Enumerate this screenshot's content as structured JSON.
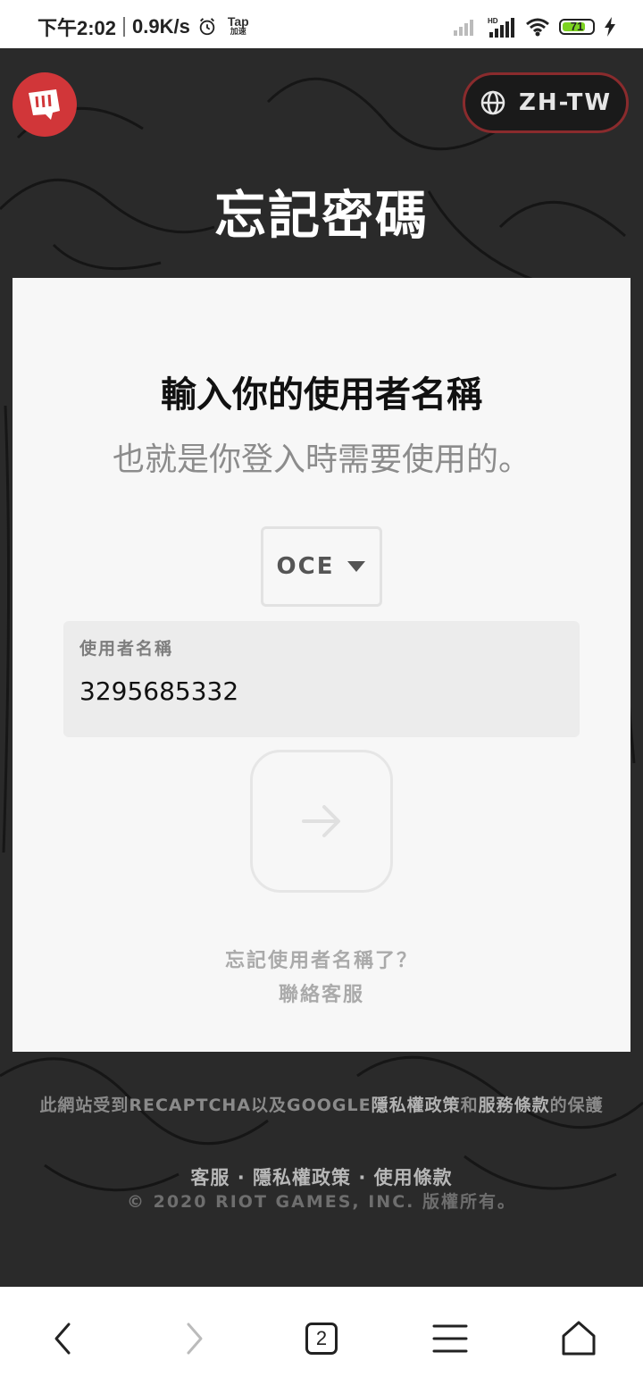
{
  "status_bar": {
    "time": "下午2:02",
    "speed": "0.9K/s",
    "tap_top": "Tap",
    "tap_bottom": "加速",
    "battery": "71",
    "icons": [
      "alarm-icon",
      "signal-icon",
      "hd-signal-icon",
      "wifi-icon",
      "battery-icon",
      "charging-icon"
    ]
  },
  "header": {
    "language_label": "ZH-TW",
    "page_title": "忘記密碼"
  },
  "card": {
    "heading": "輸入你的使用者名稱",
    "subheading": "也就是你登入時需要使用的。",
    "region": "OCE",
    "username_label": "使用者名稱",
    "username_value": "3295685332",
    "forgot_username": "忘記使用者名稱了？",
    "contact_support": "聯絡客服"
  },
  "footer": {
    "recaptcha_prefix": "此網站受到RECAPTCHA以及GOOGLE",
    "privacy_link": "隱私權政策",
    "and": "和",
    "terms_link": "服務條款",
    "recaptcha_suffix": "的保護",
    "support": "客服",
    "privacy": "隱私權政策",
    "terms": "使用條款",
    "dot": "·",
    "copyright": "© 2020 RIOT GAMES, INC. 版權所有。"
  },
  "bottom_nav": {
    "tab_count": "2"
  },
  "colors": {
    "riot_red": "#d13639",
    "background": "#2a2a2a",
    "card": "#f7f7f7"
  }
}
